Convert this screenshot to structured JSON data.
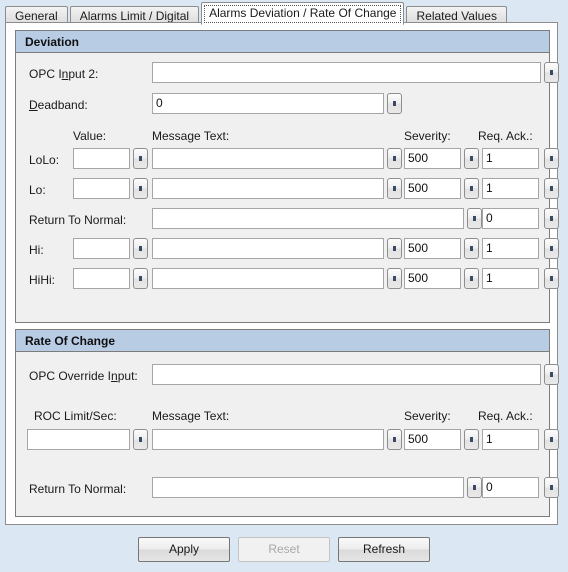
{
  "tabs": [
    {
      "label": "General",
      "active": false
    },
    {
      "label": "Alarms Limit / Digital",
      "active": false
    },
    {
      "label": "Alarms Deviation / Rate Of Change",
      "active": true
    },
    {
      "label": "Related Values",
      "active": false
    }
  ],
  "deviation": {
    "title": "Deviation",
    "opc_input_label": "OPC I",
    "opc_input_label_mnemonic": "n",
    "opc_input_label_rest": "put 2:",
    "opc_input_value": "",
    "deadband_label_mnemonic": "D",
    "deadband_label_rest": "eadband:",
    "deadband_value": "0",
    "columns": {
      "value": "Value:",
      "message_text": "Message Text:",
      "severity": "Severity:",
      "req_ack": "Req. Ack.:"
    },
    "rows": [
      {
        "label": "LoLo:",
        "value": "",
        "message": "",
        "severity": "500",
        "req_ack": "1"
      },
      {
        "label": "Lo:",
        "value": "",
        "message": "",
        "severity": "500",
        "req_ack": "1"
      },
      {
        "label": "Hi:",
        "value": "",
        "message": "",
        "severity": "500",
        "req_ack": "1"
      },
      {
        "label": "HiHi:",
        "value": "",
        "message": "",
        "severity": "500",
        "req_ack": "1"
      }
    ],
    "rtn": {
      "label": "Return To Normal:",
      "message": "",
      "req_ack": "0"
    }
  },
  "rate_of_change": {
    "title": "Rate Of Change",
    "override_label": "OPC Override I",
    "override_label_mnemonic": "n",
    "override_label_rest": "put:",
    "override_value": "",
    "columns": {
      "roc_limit": "ROC Limit/Sec:",
      "message_text": "Message Text:",
      "severity": "Severity:",
      "req_ack": "Req. Ack.:"
    },
    "row": {
      "limit": "",
      "message": "",
      "severity": "500",
      "req_ack": "1"
    },
    "rtn": {
      "label": "Return To Normal:",
      "message": "",
      "req_ack": "0"
    }
  },
  "footer": {
    "apply": "Apply",
    "reset": "Reset",
    "refresh": "Refresh"
  },
  "colors": {
    "group_header": "#b8cce4",
    "dialog_bg": "#dbe7f3",
    "group_bg": "#f0f0f0",
    "field_bg": "#ffffff"
  }
}
